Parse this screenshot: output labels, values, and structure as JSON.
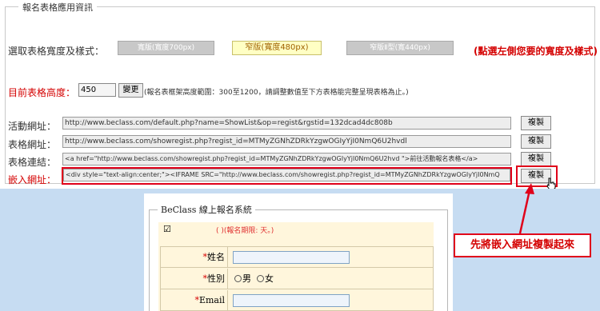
{
  "section": {
    "legend": "報名表格應用資訊"
  },
  "width_row": {
    "label": "選取表格寬度及樣式：",
    "options": [
      {
        "label": "寬版(寬度700px)",
        "selected": false
      },
      {
        "label": "窄版(寬度480px)",
        "selected": true
      },
      {
        "label": "窄版Ⅱ型(寬440px)",
        "selected": false
      }
    ],
    "hint": "(點選左側您要的寬度及樣式)"
  },
  "height_row": {
    "label": "目前表格高度：",
    "value": "450",
    "change_button": "變更",
    "note": "(報名表框架高度範圍：300至1200，請調整數值至下方表格能完整呈現表格為止。)"
  },
  "link_rows": [
    {
      "label": "活動網址：",
      "value": "http://www.beclass.com/default.php?name=ShowList&op=regist&rgstid=132dcad4dc808b",
      "copy": "複製",
      "highlight": false
    },
    {
      "label": "表格網址：",
      "value": "http://www.beclass.com/showregist.php?regist_id=MTMyZGNhZDRkYzgwOGIyYjI0NmQ6U2hvdl",
      "copy": "複製",
      "highlight": false
    },
    {
      "label": "表格連結：",
      "value": "<a href=\"http://www.beclass.com/showregist.php?regist_id=MTMyZGNhZDRkYzgwOGIyYjI0NmQ6U2hvd        \">前往活動報名表格</a>",
      "copy": "複製",
      "highlight": false
    },
    {
      "label": "嵌入網址：",
      "value": "<div style=\"text-align:center;\"><IFRAME SRC=\"http://www.beclass.com/showregist.php?regist_id=MTMyZGNhZDRkYzgwOGIyYjI0NmQ",
      "copy": "複製",
      "highlight": true
    }
  ],
  "preview": {
    "legend": "BeClass 線上報名系統",
    "checkbox": "☑",
    "note": "(            )(報名期限:   天。)",
    "fields": [
      {
        "label": "姓名",
        "required": "*"
      },
      {
        "label": "性別",
        "required": "*",
        "options": [
          "男",
          "女"
        ]
      },
      {
        "label": "Email",
        "required": "*"
      }
    ]
  },
  "callout": {
    "text": "先將嵌入網址複製起來"
  },
  "colors": {
    "accent_red": "#e0001a",
    "preview_bg": "#c6dcf2",
    "form_cream": "#fff6dc"
  },
  "icons": [
    "cursor-hand-icon",
    "arrow-icon"
  ]
}
